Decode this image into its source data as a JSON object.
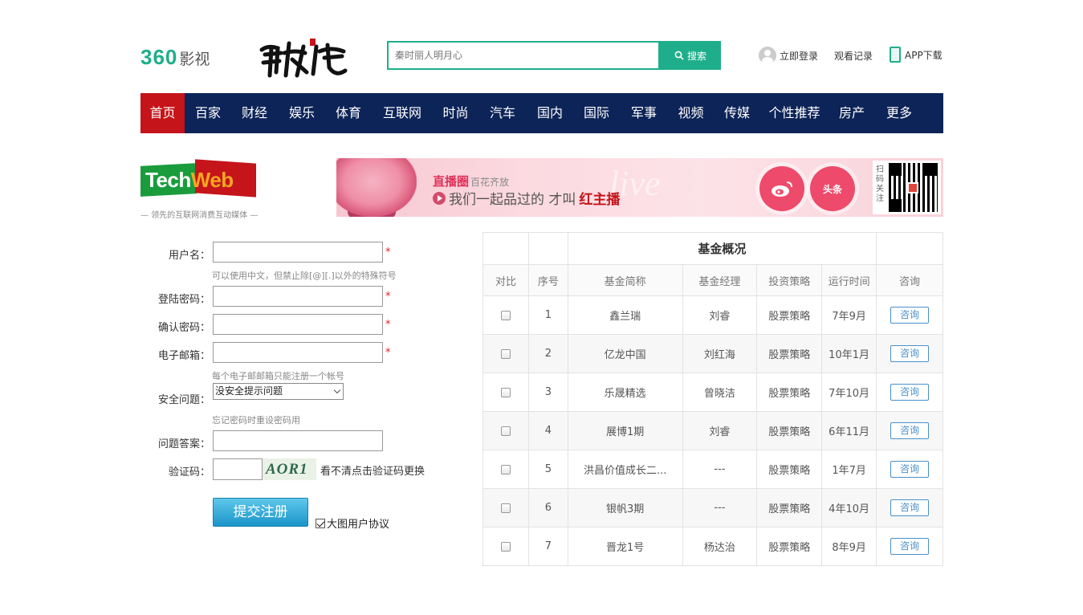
{
  "header": {
    "logo_num": "360",
    "logo_text": "影视",
    "drama_title": "丽姬传",
    "search_placeholder": "秦时丽人明月心",
    "search_button": "搜索",
    "login": "立即登录",
    "history": "观看记录",
    "app": "APP下载"
  },
  "nav": {
    "items": [
      "首页",
      "百家",
      "财经",
      "娱乐",
      "体育",
      "互联网",
      "时尚",
      "汽车",
      "国内",
      "国际",
      "军事",
      "视频",
      "传媒",
      "个性推荐",
      "房产",
      "更多"
    ]
  },
  "techweb": {
    "tech": "Tech",
    "web": "Web",
    "slogan": "— 领先的互联网消费互动媒体 —"
  },
  "banner": {
    "title": "直播圈",
    "subtitle": "百花齐放",
    "line_a": "我们一起品过的  才叫",
    "line_b": "红主播",
    "live": "live",
    "weibo": "微博",
    "toutiao": "头条",
    "qr_label": "扫码关注"
  },
  "form": {
    "username_label": "用户名：",
    "username_hint": "可以使用中文，但禁止除[@][.]以外的特殊符号",
    "password_label": "登陆密码：",
    "confirm_label": "确认密码：",
    "email_label": "电子邮箱：",
    "email_hint": "每个电子邮邮箱只能注册一个帐号",
    "question_label": "安全问题：",
    "question_value": "没安全提示问题",
    "question_hint": "忘记密码时重设密码用",
    "answer_label": "问题答案：",
    "captcha_label": "验证码：",
    "captcha_text": "AOR1",
    "captcha_tip": "看不清点击验证码更换",
    "required_mark": "*",
    "submit": "提交注册",
    "agree": "大图用户协议"
  },
  "fund": {
    "title": "基金概况",
    "headers": [
      "对比",
      "序号",
      "基金简称",
      "基金经理",
      "投资策略",
      "运行时间",
      "咨询"
    ],
    "rows": [
      {
        "no": "1",
        "name": "鑫兰瑞",
        "manager": "刘睿",
        "strategy": "股票策略",
        "runtime": "7年9月",
        "consult": "咨询"
      },
      {
        "no": "2",
        "name": "亿龙中国",
        "manager": "刘红海",
        "strategy": "股票策略",
        "runtime": "10年1月",
        "consult": "咨询"
      },
      {
        "no": "3",
        "name": "乐晟精选",
        "manager": "曾晓洁",
        "strategy": "股票策略",
        "runtime": "7年10月",
        "consult": "咨询"
      },
      {
        "no": "4",
        "name": "展博1期",
        "manager": "刘睿",
        "strategy": "股票策略",
        "runtime": "6年11月",
        "consult": "咨询"
      },
      {
        "no": "5",
        "name": "洪昌价值成长二...",
        "manager": "---",
        "strategy": "股票策略",
        "runtime": "1年7月",
        "consult": "咨询"
      },
      {
        "no": "6",
        "name": "银帆3期",
        "manager": "---",
        "strategy": "股票策略",
        "runtime": "4年10月",
        "consult": "咨询"
      },
      {
        "no": "7",
        "name": "晋龙1号",
        "manager": "杨达治",
        "strategy": "股票策略",
        "runtime": "8年9月",
        "consult": "咨询"
      }
    ]
  }
}
